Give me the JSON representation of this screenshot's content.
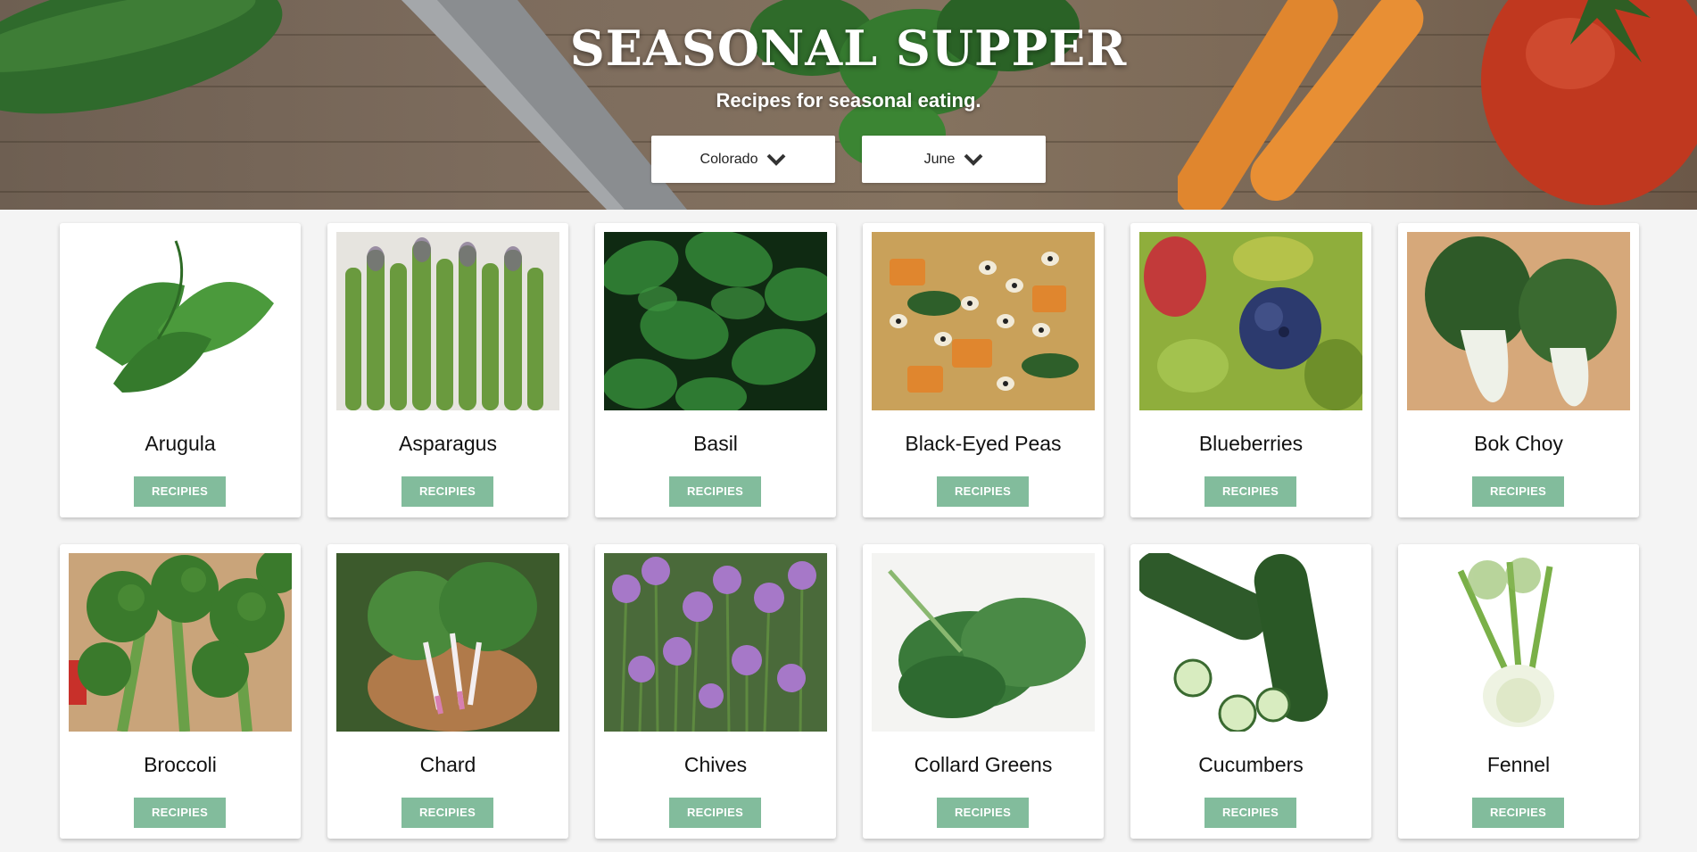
{
  "hero": {
    "title": "SEASONAL SUPPER",
    "subtitle": "Recipes for seasonal eating.",
    "location_select": {
      "value": "Colorado"
    },
    "month_select": {
      "value": "June"
    }
  },
  "colors": {
    "button": "#82bc9c",
    "background": "#f4f4f4"
  },
  "produce": [
    {
      "name": "Arugula",
      "button": "RECIPIES",
      "icon": "arugula-image"
    },
    {
      "name": "Asparagus",
      "button": "RECIPIES",
      "icon": "asparagus-image"
    },
    {
      "name": "Basil",
      "button": "RECIPIES",
      "icon": "basil-image"
    },
    {
      "name": "Black-Eyed Peas",
      "button": "RECIPIES",
      "icon": "black-eyed-peas-image"
    },
    {
      "name": "Blueberries",
      "button": "RECIPIES",
      "icon": "blueberries-image"
    },
    {
      "name": "Bok Choy",
      "button": "RECIPIES",
      "icon": "bok-choy-image"
    },
    {
      "name": "Broccoli",
      "button": "RECIPIES",
      "icon": "broccoli-image"
    },
    {
      "name": "Chard",
      "button": "RECIPIES",
      "icon": "chard-image"
    },
    {
      "name": "Chives",
      "button": "RECIPIES",
      "icon": "chives-image"
    },
    {
      "name": "Collard Greens",
      "button": "RECIPIES",
      "icon": "collard-greens-image"
    },
    {
      "name": "Cucumbers",
      "button": "RECIPIES",
      "icon": "cucumbers-image"
    },
    {
      "name": "Fennel",
      "button": "RECIPIES",
      "icon": "fennel-image"
    }
  ]
}
